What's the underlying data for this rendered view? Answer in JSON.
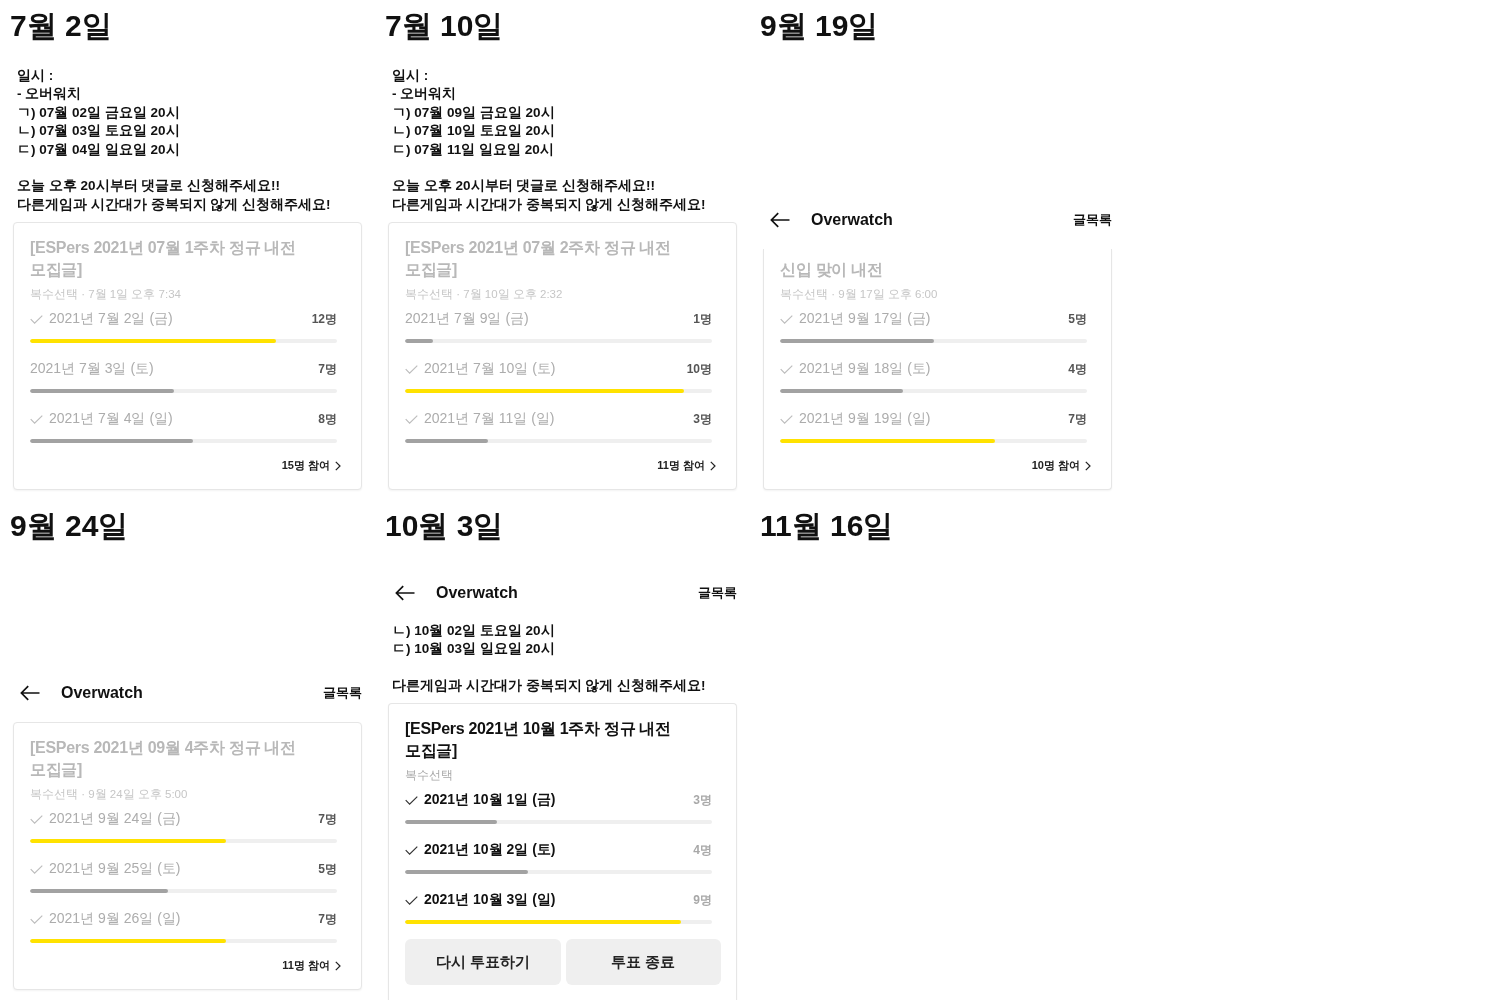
{
  "panels": [
    {
      "date": "7월 2일",
      "post_paragraphs": [
        [
          "일시 :",
          "- 오버워치",
          "ㄱ) 07월 02일 금요일 20시",
          "ㄴ) 07월 03일 토요일 20시",
          "ㄷ) 07월 04일 일요일 20시"
        ],
        [
          "오늘 오후 20시부터 댓글로 신청해주세요!!",
          "다른게임과 시간대가 중복되지 않게 신청해주세요!"
        ]
      ],
      "poll": {
        "closed": true,
        "top_cut_off": false,
        "bottom_cut_off": false,
        "title": "[ESPers 2021년 07월 1주차 정규 내전 모집글]",
        "meta": "복수선택 · 7월 1일 오후 7:34",
        "options": [
          {
            "label": "2021년 7월 2일 (금)",
            "count": "12명",
            "voted": true,
            "leading": true,
            "level": 0.8
          },
          {
            "label": "2021년 7월 3일 (토)",
            "count": "7명",
            "voted": false,
            "leading": false,
            "level": 0.47
          },
          {
            "label": "2021년 7월 4일 (일)",
            "count": "8명",
            "voted": true,
            "leading": false,
            "level": 0.53
          }
        ],
        "participants": "15명 참여"
      }
    },
    {
      "date": "7월 10일",
      "post_paragraphs": [
        [
          "일시 :",
          "- 오버워치",
          "ㄱ) 07월 09일 금요일 20시",
          "ㄴ) 07월 10일 토요일 20시",
          "ㄷ) 07월 11일 일요일 20시"
        ],
        [
          "오늘 오후 20시부터 댓글로 신청해주세요!!",
          "다른게임과 시간대가 중복되지 않게 신청해주세요!"
        ]
      ],
      "poll": {
        "closed": true,
        "top_cut_off": false,
        "bottom_cut_off": false,
        "title": "[ESPers 2021년 07월 2주차 정규 내전 모집글]",
        "meta": "복수선택 · 7월 10일 오후 2:32",
        "options": [
          {
            "label": "2021년 7월 9일 (금)",
            "count": "1명",
            "voted": false,
            "leading": false,
            "level": 0.09
          },
          {
            "label": "2021년 7월 10일 (토)",
            "count": "10명",
            "voted": true,
            "leading": true,
            "level": 0.91
          },
          {
            "label": "2021년 7월 11일 (일)",
            "count": "3명",
            "voted": true,
            "leading": false,
            "level": 0.27
          }
        ],
        "participants": "11명 참여"
      }
    },
    {
      "date": "9월 19일",
      "app_bar": {
        "title": "Overwatch",
        "action": "글목록"
      },
      "poll": {
        "closed": true,
        "top_cut_off": true,
        "bottom_cut_off": false,
        "title": "신입 맞이 내전",
        "meta": "복수선택 · 9월 17일 오후 6:00",
        "options": [
          {
            "label": "2021년 9월 17일 (금)",
            "count": "5명",
            "voted": true,
            "leading": false,
            "level": 0.5
          },
          {
            "label": "2021년 9월 18일 (토)",
            "count": "4명",
            "voted": true,
            "leading": false,
            "level": 0.4
          },
          {
            "label": "2021년 9월 19일 (일)",
            "count": "7명",
            "voted": true,
            "leading": true,
            "level": 0.7
          }
        ],
        "participants": "10명 참여"
      }
    },
    {
      "date": "9월 24일",
      "app_bar": {
        "title": "Overwatch",
        "action": "글목록"
      },
      "poll": {
        "closed": true,
        "top_cut_off": false,
        "bottom_cut_off": false,
        "title": "[ESPers 2021년 09월 4주차 정규 내전 모집글]",
        "meta": "복수선택 · 9월 24일 오후 5:00",
        "options": [
          {
            "label": "2021년 9월 24일 (금)",
            "count": "7명",
            "voted": true,
            "leading": true,
            "level": 0.64
          },
          {
            "label": "2021년 9월 25일 (토)",
            "count": "5명",
            "voted": true,
            "leading": false,
            "level": 0.45
          },
          {
            "label": "2021년 9월 26일 (일)",
            "count": "7명",
            "voted": true,
            "leading": true,
            "level": 0.64
          }
        ],
        "participants": "11명 참여"
      }
    },
    {
      "date": "10월 3일",
      "app_bar": {
        "title": "Overwatch",
        "action": "글목록"
      },
      "post_paragraphs": [
        [
          "ㄴ) 10월 02일 토요일 20시",
          "ㄷ) 10월 03일 일요일 20시"
        ],
        [
          "다른게임과 시간대가 중복되지 않게 신청해주세요!"
        ]
      ],
      "poll": {
        "closed": false,
        "top_cut_off": false,
        "bottom_cut_off": true,
        "title": "[ESPers 2021년 10월 1주차 정규 내전 모집글]",
        "meta": "복수선택",
        "options": [
          {
            "label": "2021년 10월 1일 (금)",
            "count": "3명",
            "voted": true,
            "leading": false,
            "level": 0.3
          },
          {
            "label": "2021년 10월 2일 (토)",
            "count": "4명",
            "voted": true,
            "leading": false,
            "level": 0.4
          },
          {
            "label": "2021년 10월 3일 (일)",
            "count": "9명",
            "voted": true,
            "leading": true,
            "level": 0.9
          }
        ],
        "buttons": [
          "다시 투표하기",
          "투표 종료"
        ]
      }
    },
    {
      "date": "11월 16일"
    }
  ]
}
